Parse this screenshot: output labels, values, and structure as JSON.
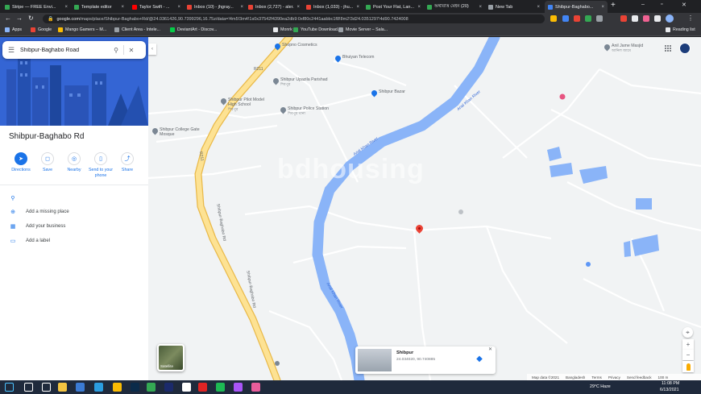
{
  "tabs": [
    {
      "title": "Stripe — FREE Envi...",
      "active": false,
      "icon_color": "#34a853"
    },
    {
      "title": "Template editor",
      "active": false,
      "icon_color": "#34a853"
    },
    {
      "title": "Taylor Swift - ...",
      "active": false,
      "icon_color": "#ff0000"
    },
    {
      "title": "Inbox (10) - jhgray...",
      "active": false,
      "icon_color": "#ea4335"
    },
    {
      "title": "Inbox (2,727) - aler...",
      "active": false,
      "icon_color": "#ea4335"
    },
    {
      "title": "Inbox (1,033) - jhu...",
      "active": false,
      "icon_color": "#ea4335"
    },
    {
      "title": "Post Your Flat, Lan...",
      "active": false,
      "icon_color": "#34a853"
    },
    {
      "title": "অর্থবিত্তি মেইন (20)",
      "active": false,
      "icon_color": "#34a853"
    },
    {
      "title": "New Tab",
      "active": false,
      "icon_color": "#9aa0a6"
    },
    {
      "title": "Shibpur-Baghabo...",
      "active": true,
      "icon_color": "#4285f4"
    }
  ],
  "window_controls": {
    "minimize": "–",
    "maximize": "▫",
    "close": "✕"
  },
  "address_bar": {
    "host": "google.com",
    "path": "/maps/place/Shibpur-Baghabo+Rd/@24.0361426,90.7399296,16.75z/data=!4m5!3m4!1s0x37542f4390ea2db9:0xf80c2441aabbc1f8!8m2!3d24.0351297!4d90.7424008"
  },
  "bookmarks": [
    {
      "label": "Apps",
      "color": "#8ab4f8"
    },
    {
      "label": "Google",
      "color": "#ea4335"
    },
    {
      "label": "Mango Gamers – M...",
      "color": "#fbbc04"
    },
    {
      "label": "Client Area - Intele...",
      "color": "#9aa0a6"
    },
    {
      "label": "DeviantArt - Discov...",
      "color": "#05cc47"
    },
    {
      "label": "Monrk",
      "color": "#e8eaed"
    },
    {
      "label": "YouTube Download...",
      "color": "#34a853"
    },
    {
      "label": "Movie Server – Sala...",
      "color": "#9aa0a6"
    }
  ],
  "reading_list": "Reading list",
  "search": {
    "value": "Shibpur-Baghabo Road",
    "placeholder": "Search Google Maps"
  },
  "place": {
    "title": "Shibpur-Baghabo Rd"
  },
  "actions": [
    {
      "label": "Directions",
      "icon": "directions-icon",
      "glyph": "➤",
      "primary": true
    },
    {
      "label": "Save",
      "icon": "bookmark-icon",
      "glyph": "◻",
      "primary": false
    },
    {
      "label": "Nearby",
      "icon": "nearby-icon",
      "glyph": "◎",
      "primary": false
    },
    {
      "label": "Send to your phone",
      "icon": "phone-icon",
      "glyph": "▯",
      "primary": false
    },
    {
      "label": "Share",
      "icon": "share-icon",
      "glyph": "⤴",
      "primary": false
    }
  ],
  "info_rows": [
    {
      "label": "",
      "icon": "location-pin-icon",
      "glyph": "⚲"
    },
    {
      "label": "Add a missing place",
      "icon": "add-place-icon",
      "glyph": "⊕"
    },
    {
      "label": "Add your business",
      "icon": "business-icon",
      "glyph": "▦"
    },
    {
      "label": "Add a label",
      "icon": "label-icon",
      "glyph": "▭"
    }
  ],
  "map": {
    "watermark": "bdhousing",
    "pois": [
      {
        "name": "Shopno Cosmetics",
        "sub": "",
        "color": "#1a73e8"
      },
      {
        "name": "Bhuiyan Telecom",
        "sub": "",
        "color": "#1a73e8"
      },
      {
        "name": "Shibpur Upazila Parishad",
        "sub": "শিবপুর",
        "color": "#7b8794"
      },
      {
        "name": "Shibpur Bazar",
        "sub": "",
        "color": "#1a73e8"
      },
      {
        "name": "Shibpur Pilot Model High School",
        "sub": "শিবপুর",
        "color": "#7b8794"
      },
      {
        "name": "Shibpur Police Station",
        "sub": "শিবপুর থানা",
        "color": "#7b8794"
      },
      {
        "name": "Shibpur College Gate Mosque",
        "sub": "",
        "color": "#7b8794"
      },
      {
        "name": "Anil Jame Masjid",
        "sub": "আনিল জামে",
        "color": "#7b8794"
      }
    ],
    "road_labels": [
      "R211",
      "R211",
      "Shibpur-Baghabo Rd",
      "Shibpur-Baghabo Rd",
      "Arial Khan River",
      "Arial Khan River",
      "Arial Khan River"
    ],
    "satellite_label": "Satellite",
    "card": {
      "name": "Shibpur",
      "coords": "24.034020, 90.740885"
    },
    "footer": [
      "Map data ©2021",
      "Bangladesh",
      "Terms",
      "Privacy",
      "Send feedback",
      "100 m"
    ]
  },
  "taskbar": {
    "weather": "29°C  Haze",
    "time": "11:08 PM",
    "date": "6/13/2021",
    "icons": [
      {
        "name": "windows-start-icon",
        "color": "#4cc2ff"
      },
      {
        "name": "taskbar-search-icon",
        "color": "#ffffff"
      },
      {
        "name": "task-view-icon",
        "color": "#ffffff"
      },
      {
        "name": "file-explorer-icon",
        "color": "#f4c542"
      },
      {
        "name": "app-icon",
        "color": "#3b7bd4"
      },
      {
        "name": "edge-icon",
        "color": "#2b9de0"
      },
      {
        "name": "chrome-icon",
        "color": "#fbbc04"
      },
      {
        "name": "photoshop-icon",
        "color": "#0b2b4a"
      },
      {
        "name": "app-icon",
        "color": "#34a853"
      },
      {
        "name": "photoshop-icon",
        "color": "#1b2a6b"
      },
      {
        "name": "app-icon",
        "color": "#ffffff"
      },
      {
        "name": "opera-icon",
        "color": "#e02424"
      },
      {
        "name": "app-icon",
        "color": "#1db954"
      },
      {
        "name": "messenger-icon",
        "color": "#a855f7"
      },
      {
        "name": "app-icon",
        "color": "#e85d9b"
      }
    ]
  }
}
